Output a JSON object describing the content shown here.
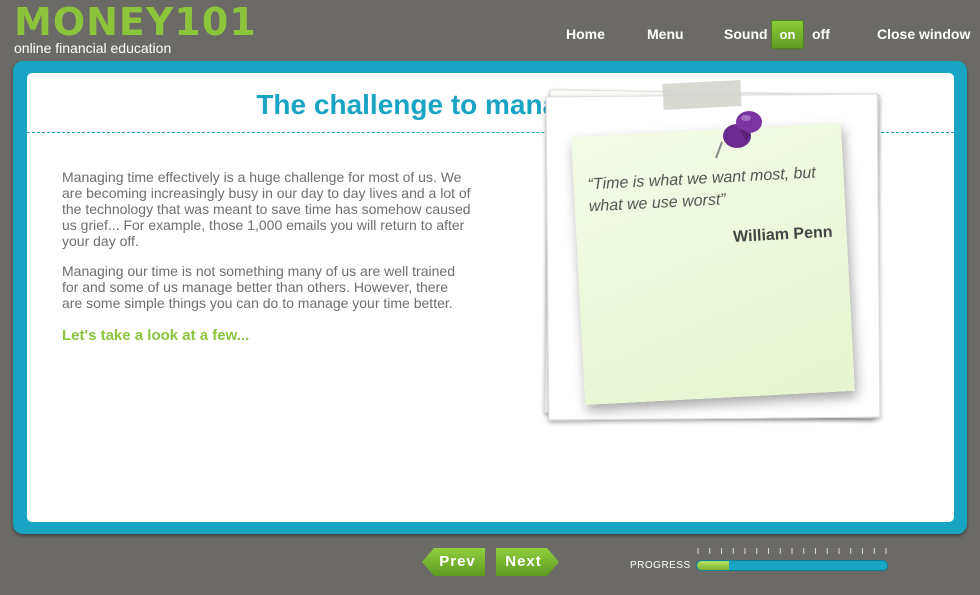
{
  "brand": {
    "name": "MONEY101",
    "tagline": "online financial education",
    "color": "#8cc43c"
  },
  "nav": {
    "home": "Home",
    "menu": "Menu",
    "sound_label": "Sound",
    "sound_on": "on",
    "sound_off": "off",
    "close": "Close window"
  },
  "page": {
    "title": "The challenge to manage your time",
    "paragraphs": [
      "Managing time effectively is a huge challenge for most of us. We are becoming increasingly busy in our day to day lives and a lot of the technology that was meant to save time has somehow caused us grief... For example, those 1,000 emails you will return to after your day off.",
      "Managing our time is not something many of us are well trained for and some of us manage better than others. However, there are some simple things you can do to manage your time better."
    ],
    "call_to_action": "Let's take a look at a few..."
  },
  "note": {
    "quote": "“Time is what we want most, but what we use worst”",
    "author": "William Penn",
    "pin_icon": "push-pin-icon"
  },
  "footer": {
    "prev": "Prev",
    "next": "Next",
    "progress_label": "PROGRESS",
    "progress_fraction": 0.17
  },
  "colors": {
    "accent": "#1aa4c4",
    "green": "#8cc43c",
    "background": "#6b6a66"
  }
}
